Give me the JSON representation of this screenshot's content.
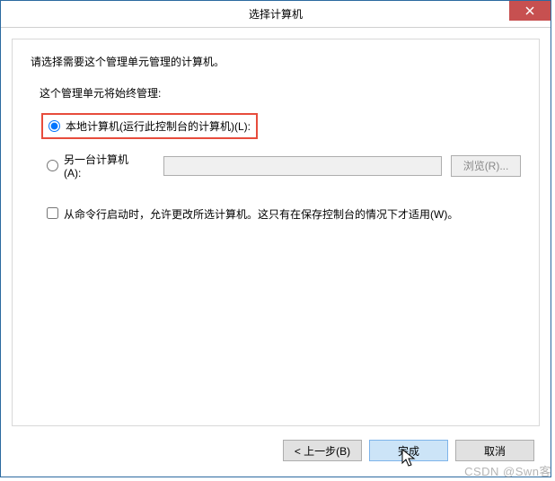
{
  "titlebar": {
    "title": "选择计算机"
  },
  "content": {
    "instruction": "请选择需要这个管理单元管理的计算机。",
    "sub_instruction": "这个管理单元将始终管理:",
    "radio_local": "本地计算机(运行此控制台的计算机)(L):",
    "radio_another": "另一台计算机(A):",
    "browse_button": "浏览(R)...",
    "checkbox_cmdline": "从命令行启动时，允许更改所选计算机。这只有在保存控制台的情况下才适用(W)。"
  },
  "buttons": {
    "back": "< 上一步(B)",
    "finish": "完成",
    "cancel": "取消"
  },
  "watermark": "CSDN @Swn客"
}
